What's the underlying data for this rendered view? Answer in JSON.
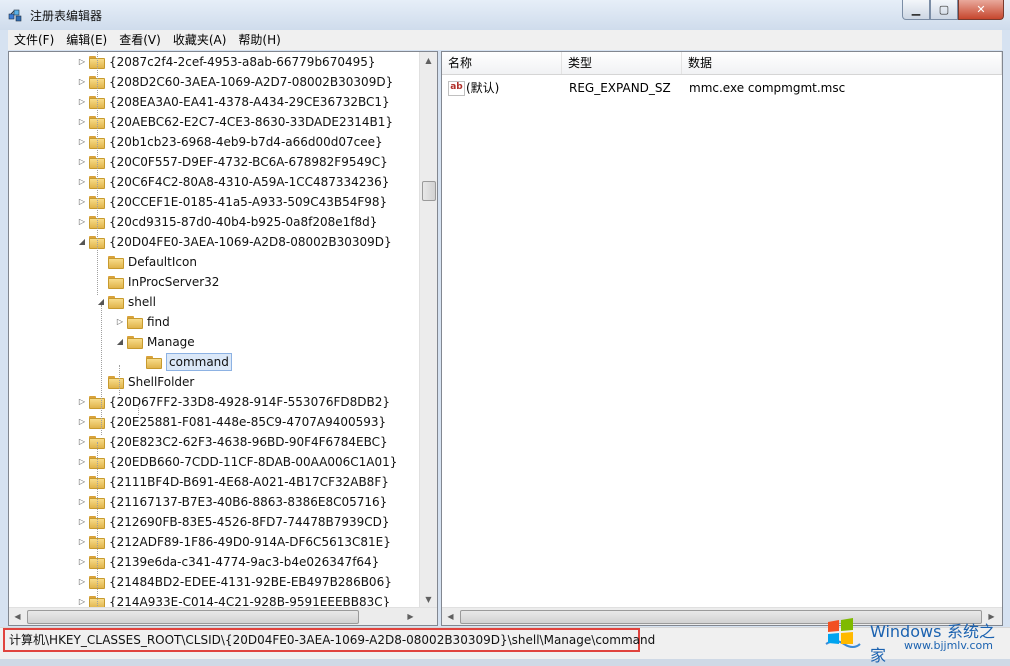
{
  "window": {
    "title": "注册表编辑器",
    "buttons": {
      "minimize": "▁",
      "maximize": "▢",
      "close": "✕"
    }
  },
  "menu": [
    "文件(F)",
    "编辑(E)",
    "查看(V)",
    "收藏夹(A)",
    "帮助(H)"
  ],
  "tree": {
    "items": [
      {
        "label": "{2087c2f4-2cef-4953-a8ab-66779b670495}",
        "level": 0,
        "expander": "▷"
      },
      {
        "label": "{208D2C60-3AEA-1069-A2D7-08002B30309D}",
        "level": 0,
        "expander": "▷"
      },
      {
        "label": "{208EA3A0-EA41-4378-A434-29CE36732BC1}",
        "level": 0,
        "expander": "▷"
      },
      {
        "label": "{20AEBC62-E2C7-4CE3-8630-33DADE2314B1}",
        "level": 0,
        "expander": "▷"
      },
      {
        "label": "{20b1cb23-6968-4eb9-b7d4-a66d00d07cee}",
        "level": 0,
        "expander": "▷"
      },
      {
        "label": "{20C0F557-D9EF-4732-BC6A-678982F9549C}",
        "level": 0,
        "expander": "▷"
      },
      {
        "label": "{20C6F4C2-80A8-4310-A59A-1CC487334236}",
        "level": 0,
        "expander": "▷"
      },
      {
        "label": "{20CCEF1E-0185-41a5-A933-509C43B54F98}",
        "level": 0,
        "expander": "▷"
      },
      {
        "label": "{20cd9315-87d0-40b4-b925-0a8f208e1f8d}",
        "level": 0,
        "expander": "▷"
      },
      {
        "label": "{20D04FE0-3AEA-1069-A2D8-08002B30309D}",
        "level": 0,
        "expander": "◢"
      },
      {
        "label": "DefaultIcon",
        "level": 1,
        "expander": ""
      },
      {
        "label": "InProcServer32",
        "level": 1,
        "expander": ""
      },
      {
        "label": "shell",
        "level": 1,
        "expander": "◢"
      },
      {
        "label": "find",
        "level": 2,
        "expander": "▷"
      },
      {
        "label": "Manage",
        "level": 2,
        "expander": "◢"
      },
      {
        "label": "command",
        "level": 3,
        "expander": "",
        "selected": true
      },
      {
        "label": "ShellFolder",
        "level": 1,
        "expander": ""
      },
      {
        "label": "{20D67FF2-33D8-4928-914F-553076FD8DB2}",
        "level": 0,
        "expander": "▷"
      },
      {
        "label": "{20E25881-F081-448e-85C9-4707A9400593}",
        "level": 0,
        "expander": "▷"
      },
      {
        "label": "{20E823C2-62F3-4638-96BD-90F4F6784EBC}",
        "level": 0,
        "expander": "▷"
      },
      {
        "label": "{20EDB660-7CDD-11CF-8DAB-00AA006C1A01}",
        "level": 0,
        "expander": "▷"
      },
      {
        "label": "{2111BF4D-B691-4E68-A021-4B17CF32AB8F}",
        "level": 0,
        "expander": "▷"
      },
      {
        "label": "{21167137-B7E3-40B6-8863-8386E8C05716}",
        "level": 0,
        "expander": "▷"
      },
      {
        "label": "{212690FB-83E5-4526-8FD7-74478B7939CD}",
        "level": 0,
        "expander": "▷"
      },
      {
        "label": "{212ADF89-1F86-49D0-914A-DF6C5613C81E}",
        "level": 0,
        "expander": "▷"
      },
      {
        "label": "{2139e6da-c341-4774-9ac3-b4e026347f64}",
        "level": 0,
        "expander": "▷"
      },
      {
        "label": "{21484BD2-EDEE-4131-92BE-EB497B286B06}",
        "level": 0,
        "expander": "▷"
      },
      {
        "label": "{214A933E-C014-4C21-928B-9591EEEBB83C}",
        "level": 0,
        "expander": "▷"
      }
    ]
  },
  "list": {
    "columns": [
      "名称",
      "类型",
      "数据"
    ],
    "rows": [
      {
        "name": "(默认)",
        "type": "REG_EXPAND_SZ",
        "data": "mmc.exe compmgmt.msc",
        "icon": "ab-string-icon"
      }
    ]
  },
  "icons": {
    "ab_glyph": "ab"
  },
  "status": {
    "path": "计算机\\HKEY_CLASSES_ROOT\\CLSID\\{20D04FE0-3AEA-1069-A2D8-08002B30309D}\\shell\\Manage\\command"
  },
  "watermark": {
    "brand": "Windows",
    "brand_cn": "系统之家",
    "url": "www.bjjmlv.com"
  },
  "colors": {
    "highlight_border": "#e0433d",
    "selection": "#dbe8f8"
  }
}
